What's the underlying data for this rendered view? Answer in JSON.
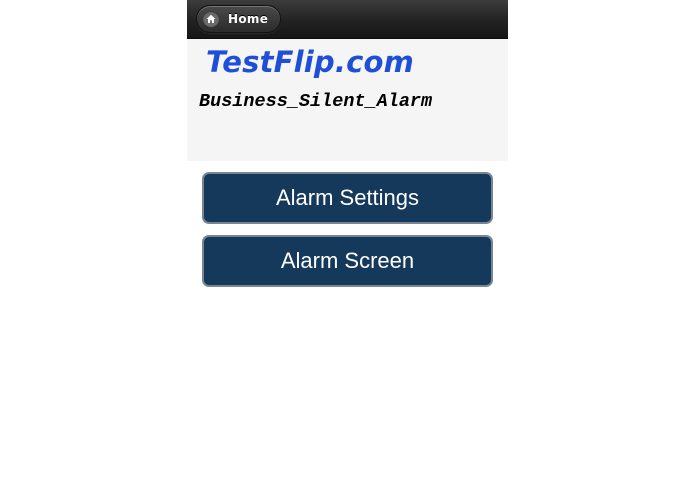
{
  "header": {
    "home_label": "Home"
  },
  "brand": {
    "name": "TestFlip.com",
    "color": "#1f4fd6"
  },
  "app": {
    "title": "Business_Silent_Alarm"
  },
  "menu": {
    "items": [
      {
        "label": "Alarm Settings"
      },
      {
        "label": "Alarm Screen"
      }
    ],
    "button_color": "#14395a",
    "button_border_color": "#7a8593"
  },
  "icons": {
    "home": "home-icon"
  }
}
